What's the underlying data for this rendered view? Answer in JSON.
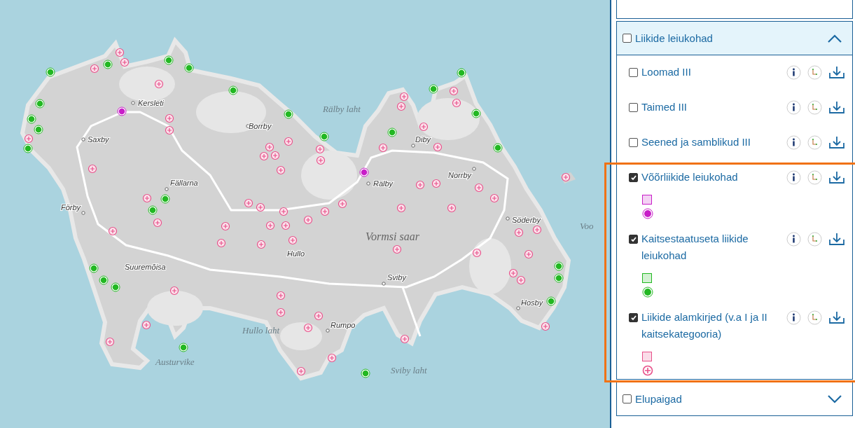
{
  "map": {
    "place_labels": [
      {
        "kind": "village",
        "text": "Kersleti"
      },
      {
        "kind": "village",
        "text": "Saxby"
      },
      {
        "kind": "village",
        "text": "Borrby"
      },
      {
        "kind": "village",
        "text": "Fällarna"
      },
      {
        "kind": "village",
        "text": "Förby"
      },
      {
        "kind": "village",
        "text": "Suuremõisa"
      },
      {
        "kind": "village",
        "text": "Hullo"
      },
      {
        "kind": "water",
        "text": "Rälby laht"
      },
      {
        "kind": "village",
        "text": "Diby"
      },
      {
        "kind": "village",
        "text": "Rälby"
      },
      {
        "kind": "village",
        "text": "Norrby"
      },
      {
        "kind": "village",
        "text": "Söderby"
      },
      {
        "kind": "island",
        "text": "Vormsi saar"
      },
      {
        "kind": "village",
        "text": "Sviby"
      },
      {
        "kind": "village",
        "text": "Hosby"
      },
      {
        "kind": "water",
        "text": "Hullo laht"
      },
      {
        "kind": "village",
        "text": "Rumpo"
      },
      {
        "kind": "water",
        "text": "Austurvike"
      },
      {
        "kind": "water",
        "text": "Sviby laht"
      },
      {
        "kind": "water",
        "text": "Voo"
      }
    ]
  },
  "layer_panel": {
    "groups": [
      {
        "label": "Liikide leiukohad",
        "checked": false,
        "expanded": true,
        "layers": [
          {
            "label": "Loomad III",
            "checked": false,
            "highlighted": false
          },
          {
            "label": "Taimed III",
            "checked": false,
            "highlighted": false
          },
          {
            "label": "Seened ja samblikud III",
            "checked": false,
            "highlighted": false
          },
          {
            "label": "Võõrliikide leiukohad",
            "checked": true,
            "highlighted": true,
            "color": "#c81ec8",
            "legend": [
              {
                "kind": "area"
              },
              {
                "kind": "dot"
              }
            ]
          },
          {
            "label": "Kaitsestaatuseta liikide leiukohad",
            "checked": true,
            "highlighted": true,
            "color": "#22b822",
            "legend": [
              {
                "kind": "area"
              },
              {
                "kind": "dot"
              }
            ]
          },
          {
            "label": "Liikide alamkirjed (v.a I ja II kaitsekategooria)",
            "checked": true,
            "highlighted": true,
            "color": "#e8508a",
            "legend": [
              {
                "kind": "area"
              },
              {
                "kind": "plus"
              }
            ]
          }
        ]
      },
      {
        "label": "Elupaigad",
        "checked": false,
        "expanded": false
      }
    ]
  }
}
